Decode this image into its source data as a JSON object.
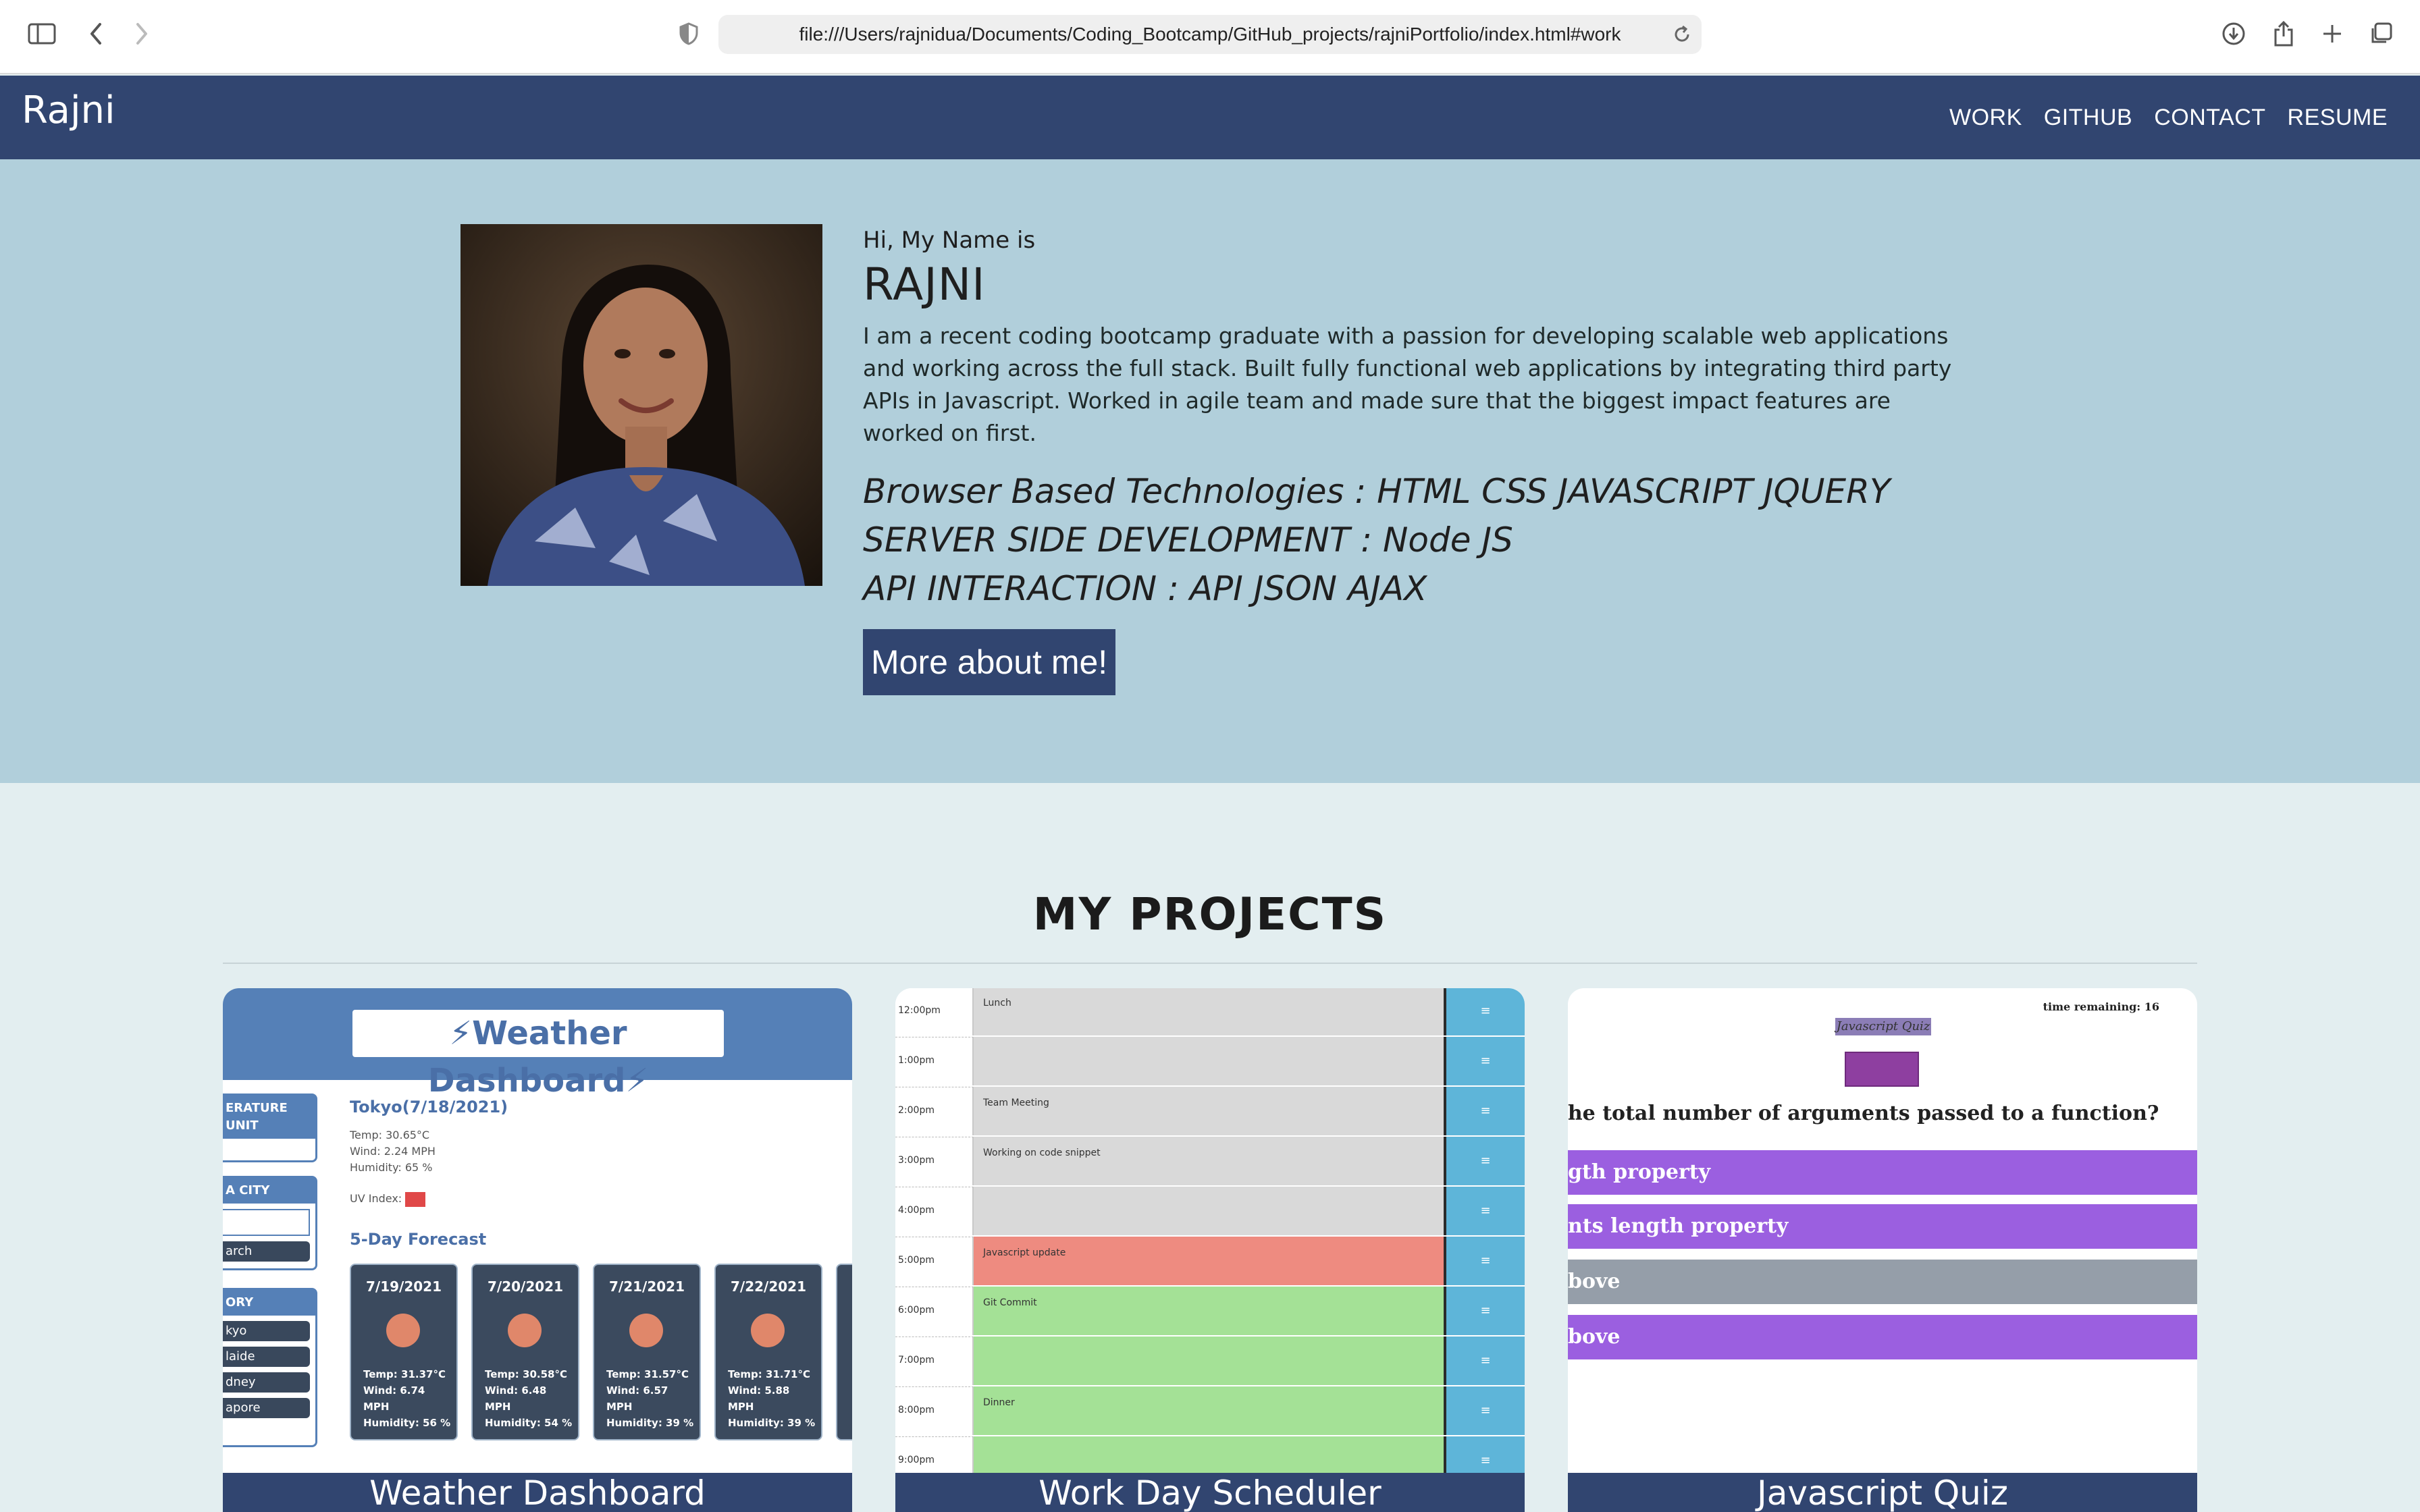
{
  "browser": {
    "url": "file:///Users/rajnidua/Documents/Coding_Bootcamp/GitHub_projects/rajniPortfolio/index.html#work"
  },
  "nav": {
    "brand": "Rajni",
    "links": [
      "WORK",
      "GITHUB",
      "CONTACT",
      "RESUME"
    ]
  },
  "hero": {
    "greeting": "Hi, My Name is",
    "name": "RAJNI",
    "bio": "I am a recent coding bootcamp graduate with a passion for developing scalable web applications and working across the full stack. Built fully functional web applications by integrating third party APIs in Javascript. Worked in agile team and made sure that the biggest impact features are worked on first.",
    "skills": [
      "Browser Based Technologies : HTML CSS JAVASCRIPT JQUERY",
      "SERVER SIDE DEVELOPMENT : Node JS",
      "API INTERACTION : API JSON AJAX"
    ],
    "button": "More about me!"
  },
  "projects": {
    "title": "MY PROJECTS",
    "cards": [
      {
        "label": "Weather Dashboard",
        "preview": {
          "title": "Weather Dashboard",
          "side_unit": "ERATURE UNIT",
          "side_city": "A CITY",
          "side_search": "arch",
          "side_history": "ORY",
          "history": [
            "kyo",
            "laide",
            "dney",
            "apore"
          ],
          "city": "Tokyo(7/18/2021)",
          "temp": "Temp: 30.65°C",
          "wind": "Wind: 2.24 MPH",
          "humidity": "Humidity: 65 %",
          "uv": "UV Index:",
          "forecast_title": "5-Day Forecast",
          "days": [
            {
              "date": "7/19/2021",
              "temp": "Temp: 31.37°C",
              "wind": "Wind: 6.74",
              "unit": "MPH",
              "hum": "Humidity: 56 %"
            },
            {
              "date": "7/20/2021",
              "temp": "Temp: 30.58°C",
              "wind": "Wind: 6.48",
              "unit": "MPH",
              "hum": "Humidity: 54 %"
            },
            {
              "date": "7/21/2021",
              "temp": "Temp: 31.57°C",
              "wind": "Wind: 6.57",
              "unit": "MPH",
              "hum": "Humidity: 39 %"
            },
            {
              "date": "7/22/2021",
              "temp": "Temp: 31.71°C",
              "wind": "Wind: 5.88",
              "unit": "MPH",
              "hum": "Humidity: 39 %"
            }
          ]
        }
      },
      {
        "label": "Work Day Scheduler",
        "preview": {
          "rows": [
            {
              "time": "12:00pm",
              "text": "Lunch",
              "color": "#d9d9d9"
            },
            {
              "time": "1:00pm",
              "text": "",
              "color": "#d9d9d9"
            },
            {
              "time": "2:00pm",
              "text": "Team Meeting",
              "color": "#d9d9d9"
            },
            {
              "time": "3:00pm",
              "text": "Working on code snippet",
              "color": "#d9d9d9"
            },
            {
              "time": "4:00pm",
              "text": "",
              "color": "#d9d9d9"
            },
            {
              "time": "5:00pm",
              "text": "Javascript update",
              "color": "#ee8b80"
            },
            {
              "time": "6:00pm",
              "text": "Git Commit",
              "color": "#a4e196"
            },
            {
              "time": "7:00pm",
              "text": "",
              "color": "#a4e196"
            },
            {
              "time": "8:00pm",
              "text": "Dinner",
              "color": "#a4e196"
            },
            {
              "time": "9:00pm",
              "text": "",
              "color": "#a4e196"
            }
          ]
        }
      },
      {
        "label": "Javascript Quiz",
        "preview": {
          "timer": "time remaining: 16",
          "title": "Javascript Quiz",
          "question": "the total number of arguments passed to a function?",
          "options": [
            {
              "text": "gth property",
              "color": "#9b5fe0"
            },
            {
              "text": "nts length property",
              "color": "#9b5fe0"
            },
            {
              "text": "bove",
              "color": "#959ea9"
            },
            {
              "text": "bove",
              "color": "#9b5fe0"
            }
          ]
        }
      }
    ]
  },
  "colors": {
    "nav_bg": "#314570",
    "hero_bg": "#b1cfdb",
    "page_bg": "#e3eef0"
  }
}
